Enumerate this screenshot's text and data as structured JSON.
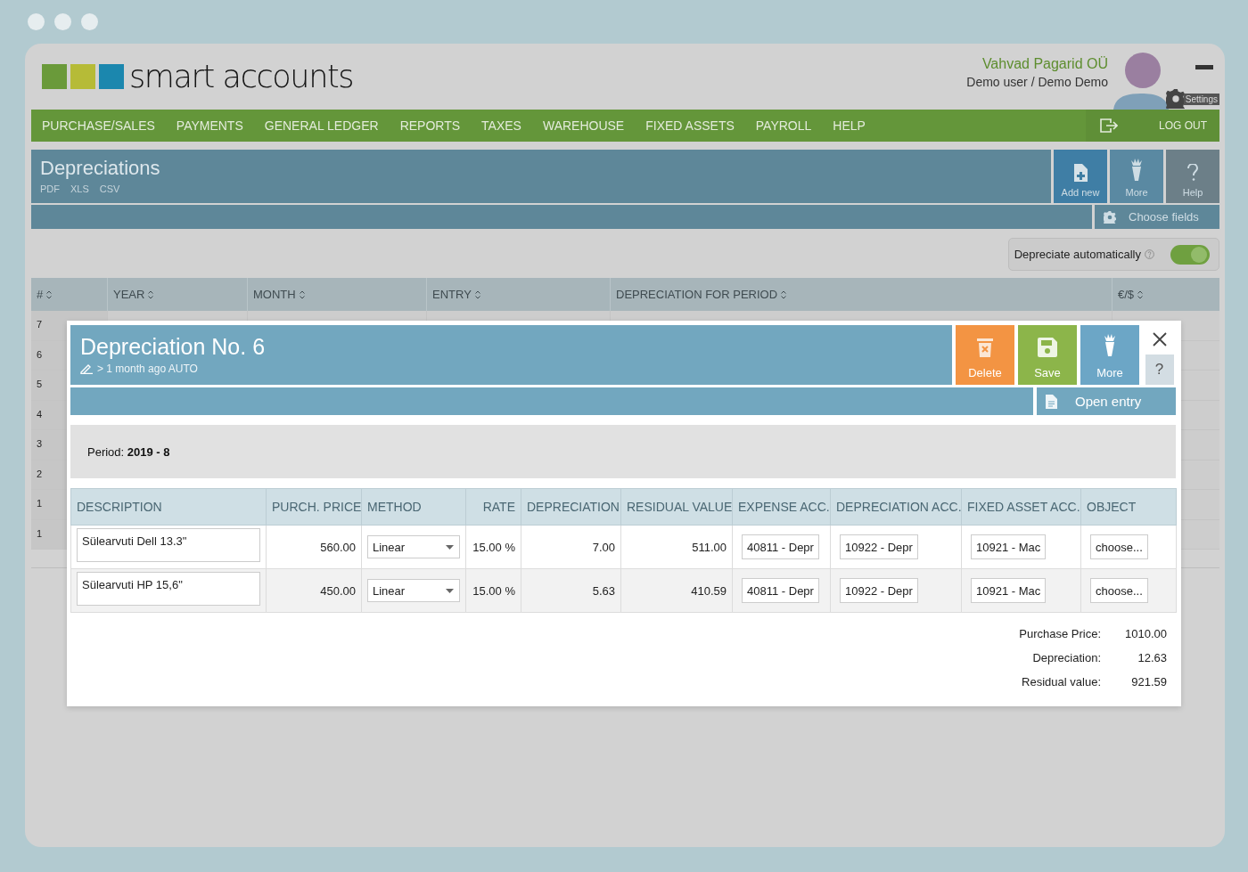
{
  "header": {
    "logo_text": "smart accounts",
    "company": "Vahvad Pagarid OÜ",
    "user": "Demo user / Demo Demo",
    "settings_label": "Settings"
  },
  "nav": {
    "items": [
      "PURCHASE/SALES",
      "PAYMENTS",
      "GENERAL LEDGER",
      "REPORTS",
      "TAXES",
      "WAREHOUSE",
      "FIXED ASSETS",
      "PAYROLL",
      "HELP"
    ],
    "logout": "LOG OUT"
  },
  "page": {
    "title": "Depreciations",
    "exports": [
      "PDF",
      "XLS",
      "CSV"
    ],
    "actions": [
      {
        "kind": "add",
        "label": "Add new"
      },
      {
        "kind": "more",
        "label": "More"
      },
      {
        "kind": "help",
        "label": "Help"
      }
    ],
    "choose_fields": "Choose fields",
    "auto_depreciate": {
      "label": "Depreciate automatically",
      "on": true
    }
  },
  "table": {
    "columns": [
      "#",
      "YEAR",
      "MONTH",
      "ENTRY",
      "DEPRECIATION FOR PERIOD",
      "€/$"
    ],
    "rows": [
      "7",
      "6",
      "5",
      "4",
      "3",
      "2",
      "1",
      "1"
    ]
  },
  "dialog": {
    "title": "Depreciation No. 6",
    "meta": "> 1 month ago AUTO",
    "actions": [
      {
        "kind": "delete",
        "label": "Delete"
      },
      {
        "kind": "save",
        "label": "Save"
      },
      {
        "kind": "more",
        "label": "More"
      }
    ],
    "help": "?",
    "open_entry": "Open entry",
    "period": "Period: **2019 - 8**",
    "columns": [
      "DESCRIPTION",
      "PURCH. PRICE",
      "METHOD",
      "RATE",
      "DEPRECIATION",
      "RESIDUAL VALUE",
      "EXPENSE ACC.",
      "DEPRECIATION ACC.",
      "FIXED ASSET ACC.",
      "OBJECT"
    ],
    "rows": [
      {
        "description": "Sülearvuti Dell 13.3\"",
        "price": "560.00",
        "method": "Linear",
        "rate": "15.00 %",
        "depreciation": "7.00",
        "residual": "511.00",
        "expense_acc": "40811 - Depr",
        "depreciation_acc": "10922 - Depr",
        "asset_acc": "10921 - Mac",
        "object": "choose..."
      },
      {
        "description": "Sülearvuti HP 15,6\"",
        "price": "450.00",
        "method": "Linear",
        "rate": "15.00 %",
        "depreciation": "5.63",
        "residual": "410.59",
        "expense_acc": "40811 - Depr",
        "depreciation_acc": "10922 - Depr",
        "asset_acc": "10921 - Mac",
        "object": "choose..."
      }
    ],
    "totals": [
      {
        "label": "Purchase Price:",
        "value": "1010.00"
      },
      {
        "label": "Depreciation:",
        "value": "12.63"
      },
      {
        "label": "Residual value:",
        "value": "921.59"
      }
    ]
  }
}
